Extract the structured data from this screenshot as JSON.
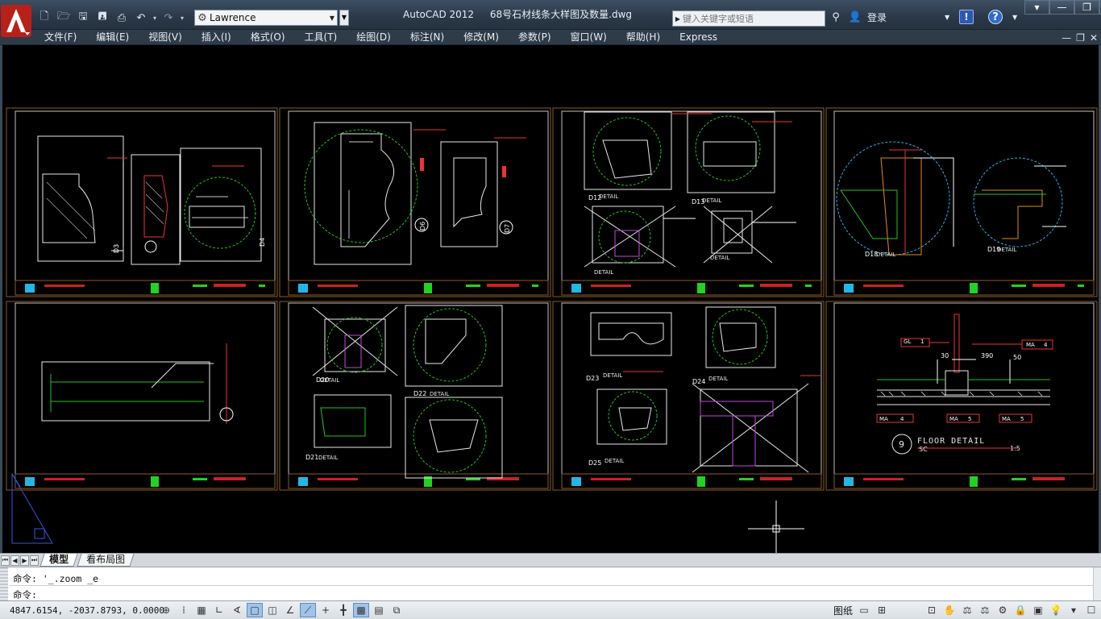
{
  "window": {
    "app_name": "AutoCAD 2012",
    "file_name": "68号石材线条大样图及数量.dwg"
  },
  "quick_access": {
    "workspace": "Lawrence"
  },
  "search": {
    "placeholder": "键入关键字或短语"
  },
  "user": {
    "login_label": "登录"
  },
  "menu": {
    "items": [
      "文件(F)",
      "编辑(E)",
      "视图(V)",
      "插入(I)",
      "格式(O)",
      "工具(T)",
      "绘图(D)",
      "标注(N)",
      "修改(M)",
      "参数(P)",
      "窗口(W)",
      "帮助(H)",
      "Express"
    ]
  },
  "drawing": {
    "sheets_row1": [
      {
        "label_a": "D3",
        "label_b": "D4"
      },
      {
        "label_a": "D6",
        "label_b": "D7"
      },
      {
        "label_a": "D12",
        "label_b": "D13"
      },
      {
        "label_a": "D18",
        "label_b": "D19"
      }
    ],
    "detail_word": "DETAIL",
    "floor_detail": {
      "number": "9",
      "title": "FLOOR DETAIL",
      "sub": "SC",
      "scale": "1:5",
      "tag_gl": "GL",
      "tag_gl_num": "1",
      "tag_ma": "MA",
      "tag_ma_num": "4",
      "dim_1": "30",
      "dim_2": "390",
      "dim_3": "50",
      "bottom_tags": [
        {
          "code": "MA",
          "num": "4"
        },
        {
          "code": "MA",
          "num": "5"
        },
        {
          "code": "MA",
          "num": "5"
        }
      ]
    },
    "labels_row2": [
      "D20",
      "D21",
      "D22",
      "D23",
      "D24",
      "D25"
    ]
  },
  "layout_tabs": {
    "tabs": [
      "模型",
      "看布局图"
    ]
  },
  "command": {
    "line1": "命令: '_.zoom _e",
    "line2": "命令:"
  },
  "status": {
    "coordinates": "4847.6154, -2037.8793, 0.0000",
    "paper_label": "图纸"
  }
}
